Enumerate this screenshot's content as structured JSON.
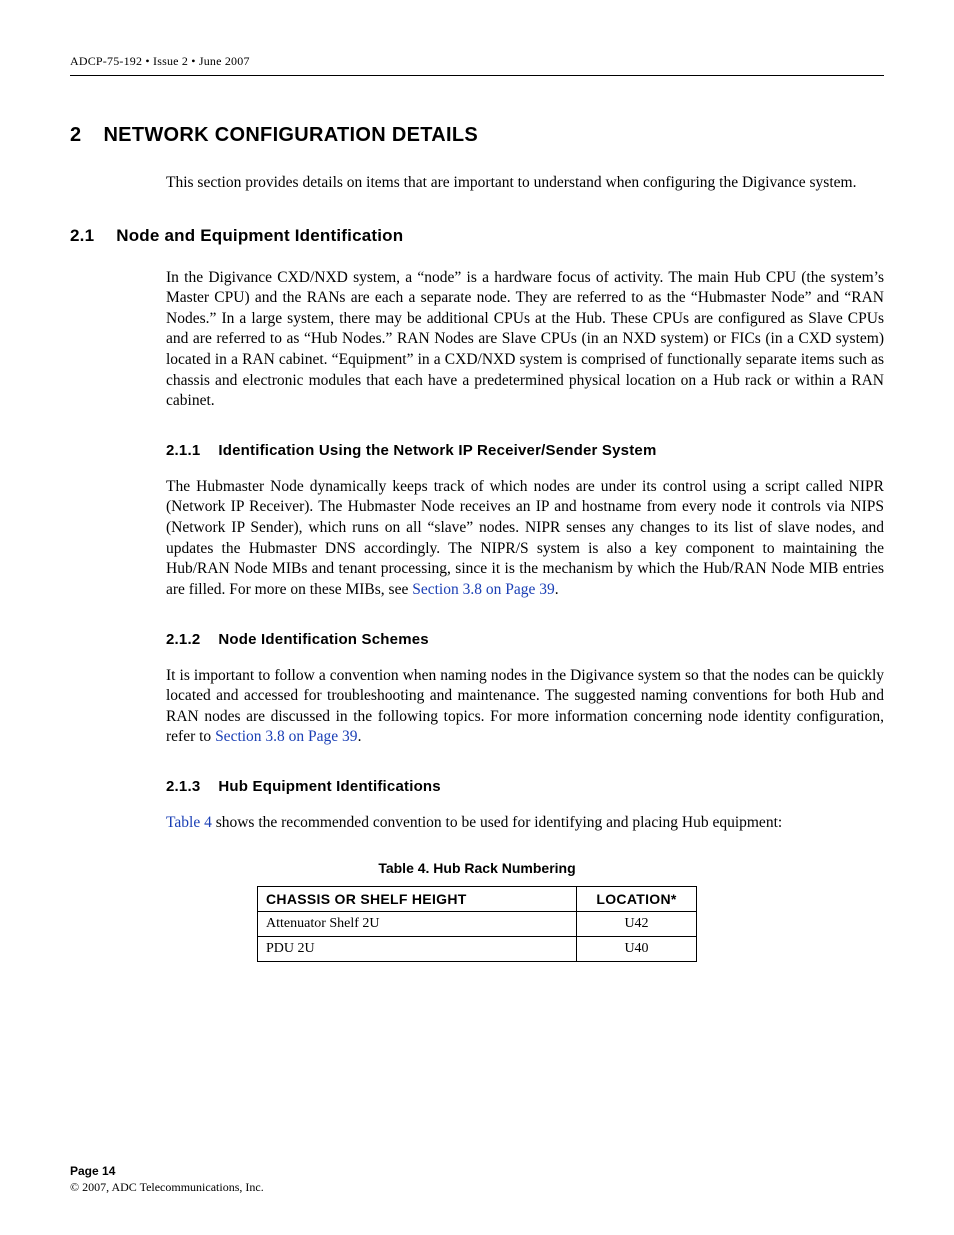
{
  "header": {
    "doc_line": "ADCP-75-192 • Issue 2 • June 2007"
  },
  "sections": {
    "major": {
      "num": "2",
      "title": "NETWORK CONFIGURATION DETAILS"
    },
    "major_intro": "This section provides details on items that are important to understand when configuring the Digivance system.",
    "s21": {
      "num": "2.1",
      "title": "Node and Equipment Identification"
    },
    "s21_body": "In the Digivance CXD/NXD system, a “node” is a hardware focus of activity. The main Hub CPU (the system’s Master CPU) and the RANs are each a separate node. They are referred to as the “Hubmaster Node” and “RAN Nodes.” In a large system, there may be additional CPUs at the Hub. These CPUs are configured as Slave CPUs and are referred to as “Hub Nodes.” RAN Nodes are Slave CPUs (in an NXD system) or FICs (in a CXD system) located in a RAN cabinet. “Equipment” in a CXD/NXD system is comprised of functionally separate items such as chassis and electronic modules that each have a predetermined physical location on a Hub rack or within a RAN cabinet.",
    "s211": {
      "num": "2.1.1",
      "title": "Identification Using the Network IP Receiver/Sender System"
    },
    "s211_body_a": "The Hubmaster Node dynamically keeps track of which nodes are under its control using a script called NIPR (Network IP Receiver). The Hubmaster Node receives an IP and hostname from every node it controls via NIPS (Network IP Sender), which runs on all “slave” nodes. NIPR senses any changes to its list of slave nodes, and updates the Hubmaster DNS accordingly. The NIPR/S system is also a key component to maintaining the Hub/RAN Node MIBs and tenant processing, since it is the mechanism by which the Hub/RAN Node MIB entries are filled. For more on these MIBs, see ",
    "s211_link": "Section 3.8 on Page 39",
    "s211_body_b": ".",
    "s212": {
      "num": "2.1.2",
      "title": "Node Identification Schemes"
    },
    "s212_body_a": "It is important to follow a convention when naming nodes in the Digivance system so that the nodes can be quickly located and accessed for troubleshooting and maintenance. The suggested naming conventions for both Hub and RAN nodes are discussed in the following topics. For more information concerning node identity configuration, refer to ",
    "s212_link": "Section 3.8 on Page 39",
    "s212_body_b": ".",
    "s213": {
      "num": "2.1.3",
      "title": "Hub Equipment Identifications"
    },
    "s213_link": "Table 4",
    "s213_body": " shows the recommended convention to be used for identifying and placing Hub equipment:"
  },
  "table4": {
    "caption": "Table 4. Hub Rack Numbering",
    "headers": {
      "c1": "CHASSIS OR SHELF HEIGHT",
      "c2": "LOCATION*"
    },
    "rows": [
      {
        "name": "Attenuator Shelf 2U",
        "loc": "U42"
      },
      {
        "name": "PDU 2U",
        "loc": "U40"
      }
    ]
  },
  "footer": {
    "page": "Page 14",
    "copyright": "© 2007, ADC Telecommunications, Inc."
  }
}
